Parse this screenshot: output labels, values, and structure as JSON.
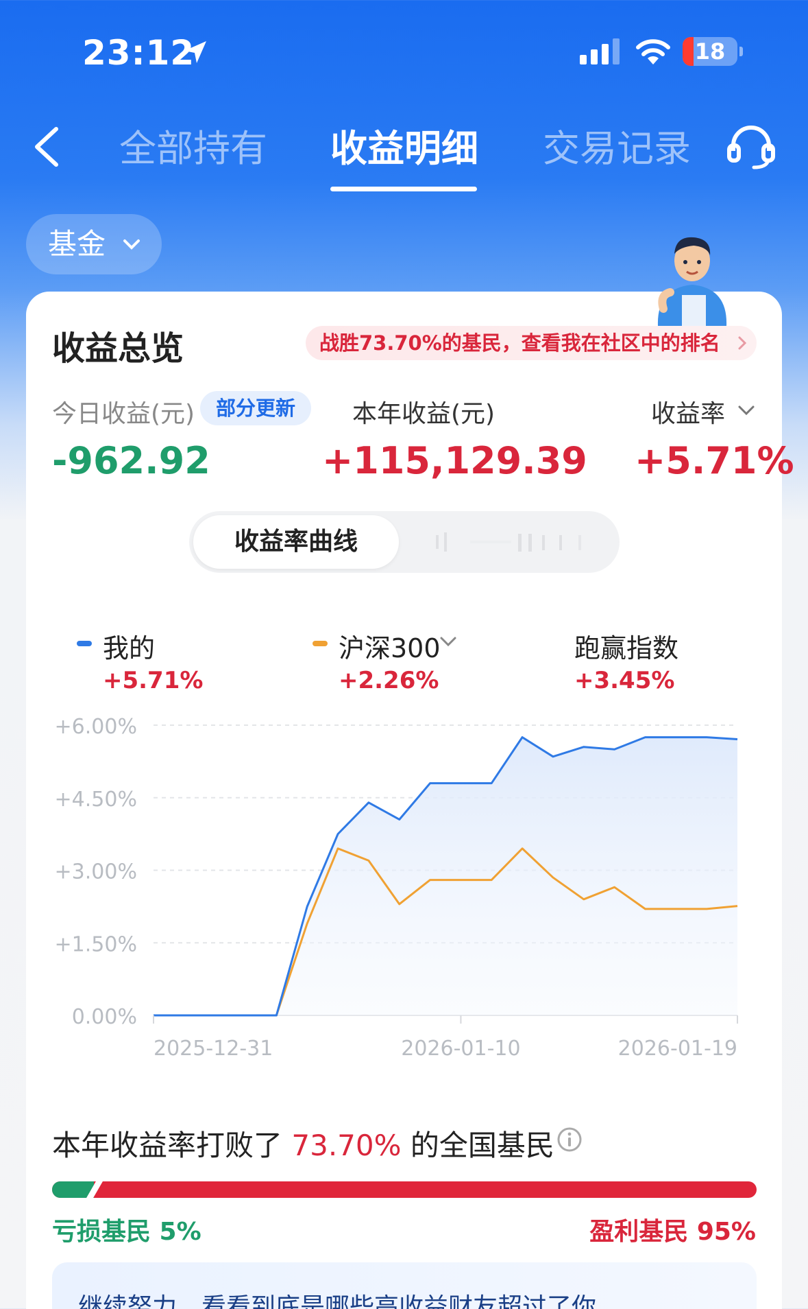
{
  "status_bar": {
    "time": "23:12",
    "battery": "18"
  },
  "nav": {
    "tabs": [
      {
        "label": "全部持有",
        "active": false
      },
      {
        "label": "收益明细",
        "active": true
      },
      {
        "label": "交易记录",
        "active": false
      }
    ]
  },
  "filter": {
    "label": "基金"
  },
  "overview": {
    "title": "收益总览",
    "rank_banner": "战胜73.70%的基民，查看我在社区中的排名",
    "today_label": "今日收益(元)",
    "update_badge": "部分更新",
    "today_value": "-962.92",
    "year_label": "本年收益(元)",
    "year_value": "+115,129.39",
    "rate_label": "收益率",
    "rate_value": "+5.71%"
  },
  "segment": {
    "active": "收益率曲线"
  },
  "legend": [
    {
      "name": "我的",
      "value": "+5.71%",
      "color": "#2f7ae5"
    },
    {
      "name": "沪深300",
      "value": "+2.26%",
      "color": "#f0a133"
    },
    {
      "name": "跑赢指数",
      "value": "+3.45%"
    }
  ],
  "chart_data": {
    "type": "line",
    "y_ticks": [
      "+6.00%",
      "+4.50%",
      "+3.00%",
      "+1.50%",
      "0.00%"
    ],
    "ylim": [
      0,
      6
    ],
    "x_ticks": [
      "2025-12-31",
      "2026-01-10",
      "2026-01-19"
    ],
    "x_tick_index": [
      0,
      10,
      19
    ],
    "series": [
      {
        "name": "我的",
        "color": "#2f7ae5",
        "values": [
          0,
          0,
          0,
          0,
          0,
          2.25,
          3.75,
          4.4,
          4.05,
          4.8,
          4.8,
          4.8,
          5.75,
          5.35,
          5.55,
          5.5,
          5.75,
          5.75,
          5.75,
          5.71
        ]
      },
      {
        "name": "沪深300",
        "color": "#f0a133",
        "values": [
          0,
          0,
          0,
          0,
          0,
          1.9,
          3.45,
          3.2,
          2.3,
          2.8,
          2.8,
          2.8,
          3.45,
          2.85,
          2.4,
          2.65,
          2.2,
          2.2,
          2.2,
          2.26
        ]
      }
    ]
  },
  "beat": {
    "prefix": "本年收益率打败了",
    "percent": "73.70%",
    "suffix": "的全国基民",
    "loss_label": "亏损基民 5%",
    "profit_label": "盈利基民 95%",
    "loss_share": 0.05
  },
  "promo": {
    "text": "继续努力，看看到底是哪些高收益财友超过了你"
  }
}
